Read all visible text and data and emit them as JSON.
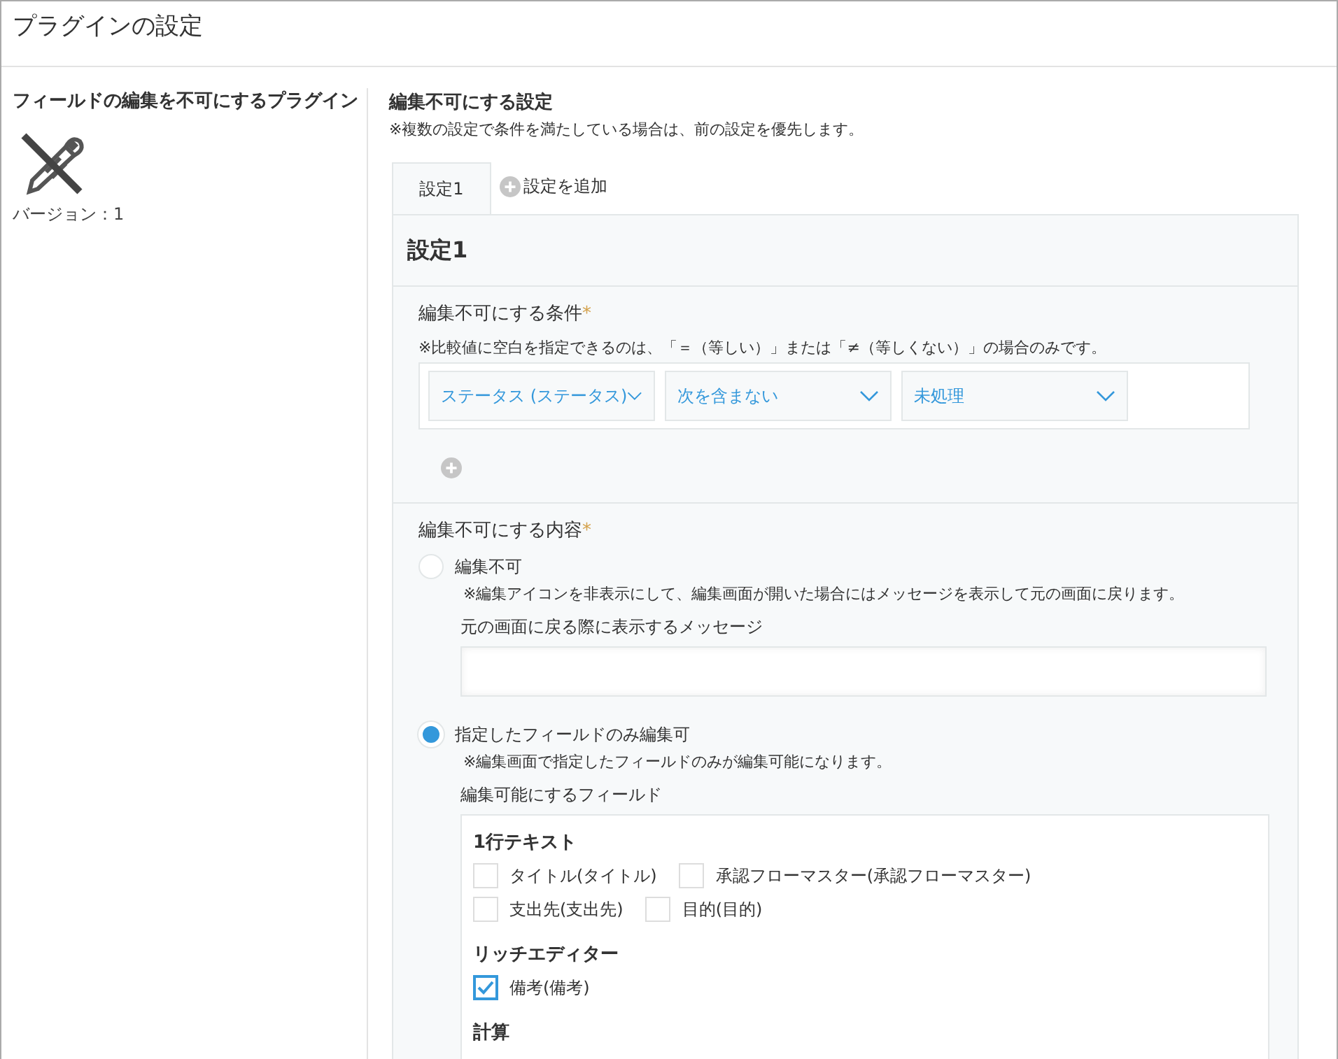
{
  "window": {
    "title": "プラグインの設定"
  },
  "plugin": {
    "name": "フィールドの編集を不可にするプラグイン",
    "version": "バージョン：1"
  },
  "settings": {
    "title": "編集不可にする設定",
    "note": "※複数の設定で条件を満たしている場合は、前の設定を優先します。",
    "tabs": [
      {
        "label": "設定1",
        "selected": true,
        "kind": "tab"
      },
      {
        "label": "設定を追加",
        "selected": false,
        "kind": "add"
      }
    ],
    "panel_title": "設定1",
    "condition": {
      "label": "編集不可にする条件",
      "required_mark": "*",
      "note": "※比較値に空白を指定できるのは、「＝（等しい）」または「≠（等しくない）」の場合のみです。",
      "selects": [
        {
          "value": "ステータス (ステータス)"
        },
        {
          "value": "次を含まない"
        },
        {
          "value": "未処理"
        }
      ]
    },
    "content": {
      "label": "編集不可にする内容",
      "required_mark": "*",
      "options": [
        {
          "kind": "message",
          "label": "編集不可",
          "selected": false,
          "note": "※編集アイコンを非表示にして、編集画面が開いた場合にはメッセージを表示して元の画面に戻ります。",
          "field_label": "元の画面に戻る際に表示するメッセージ"
        },
        {
          "kind": "fields",
          "label": "指定したフィールドのみ編集可",
          "selected": true,
          "note": "※編集画面で指定したフィールドのみが編集可能になります。",
          "field_label": "編集可能にするフィールド",
          "groups": [
            {
              "title": "1行テキスト",
              "rows": [
                [
                  {
                    "label": "タイトル(タイトル)",
                    "checked": false
                  },
                  {
                    "label": "承認フローマスター(承認フローマスター)",
                    "checked": false
                  }
                ],
                [
                  {
                    "label": "支出先(支出先)",
                    "checked": false
                  },
                  {
                    "label": "目的(目的)",
                    "checked": false
                  }
                ]
              ]
            },
            {
              "title": "リッチエディター",
              "rows": [
                [
                  {
                    "label": "備考(備考)",
                    "checked": true
                  }
                ]
              ]
            },
            {
              "title": "計算"
            }
          ]
        }
      ]
    }
  }
}
